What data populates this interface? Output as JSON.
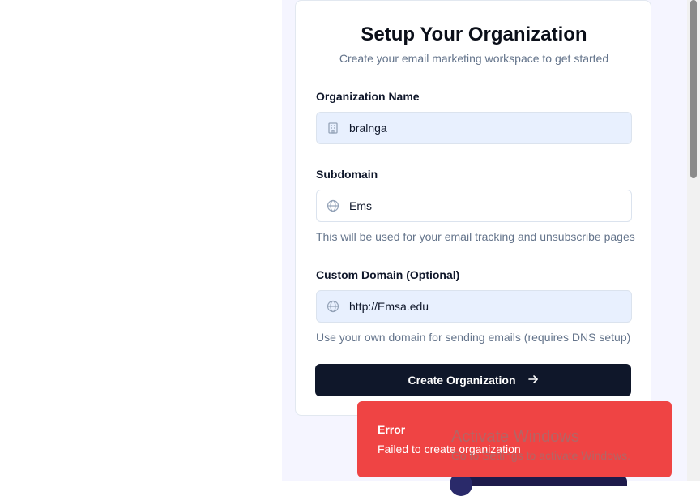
{
  "form": {
    "title": "Setup Your Organization",
    "subtitle": "Create your email marketing workspace to get started",
    "org_name": {
      "label": "Organization Name",
      "value": "bralnga",
      "icon": "building-icon"
    },
    "subdomain": {
      "label": "Subdomain",
      "value": "Ems",
      "icon": "globe-icon",
      "help": "This will be used for your email tracking and unsubscribe pages"
    },
    "custom_domain": {
      "label": "Custom Domain (Optional)",
      "value": "http://Emsa.edu",
      "icon": "globe-icon",
      "help": "Use your own domain for sending emails (requires DNS setup)"
    },
    "submit_label": "Create Organization",
    "submit_icon": "arrow-right-icon"
  },
  "toast": {
    "title": "Error",
    "message": "Failed to create organization",
    "color": "#ef4444"
  },
  "watermark": {
    "line1": "Activate Windows",
    "line2": "Go to Settings to activate Windows."
  },
  "colors": {
    "primary": "#0f172a",
    "muted": "#64748b",
    "filled_input": "#e8f0fe",
    "page_bg": "#f5f5ff"
  }
}
